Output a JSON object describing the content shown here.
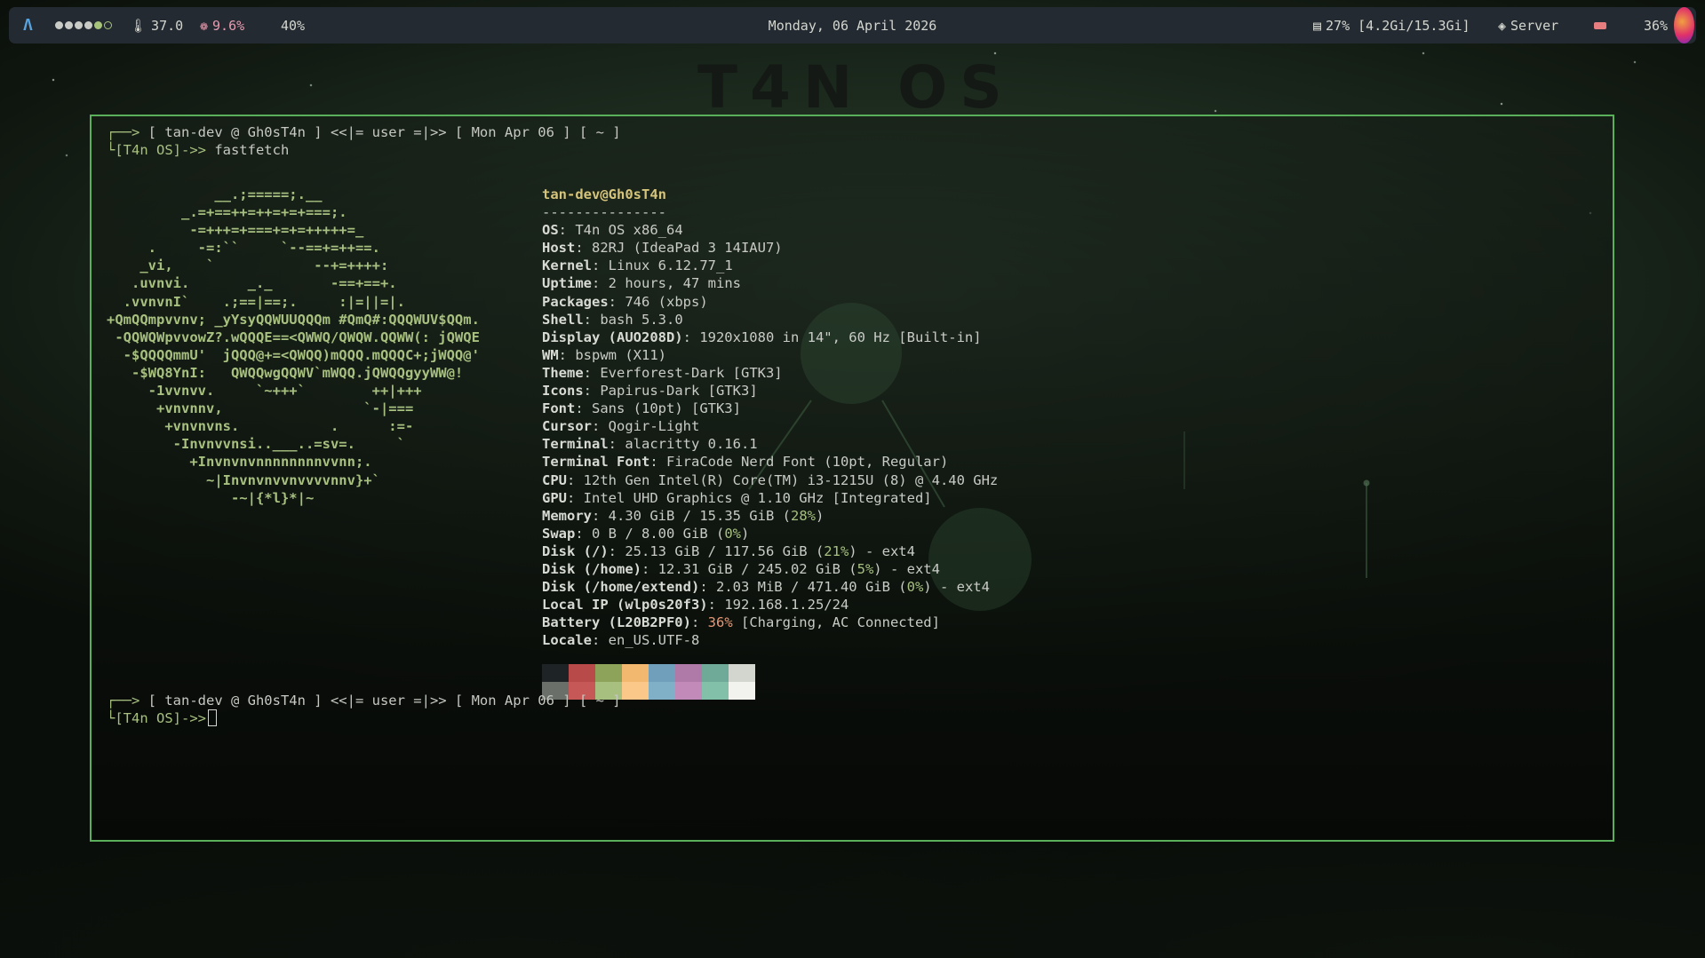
{
  "topbar": {
    "logo_icon": "arch-logo-icon",
    "workspaces": [
      true,
      true,
      true,
      true,
      true,
      false
    ],
    "temperature": "37.0",
    "cpu": "9.6%",
    "brightness": "40%",
    "clock": "Monday, 06 April 2026",
    "memory": "27% [4.2Gi/15.3Gi]",
    "network": "Server",
    "battery": "36%",
    "avatar_icon": "user-avatar"
  },
  "wallpaper_title": "T4N OS",
  "terminal": {
    "prompt1": {
      "arrow": "┌──>",
      "line": " [ tan-dev @ Gh0sT4n ] <<|= user =|>> [ Mon Apr 06 ] [ ~ ]",
      "ps": "└[T4n OS]->>",
      "cmd": " fastfetch"
    },
    "ascii_art": "             __.;=====;.__\n         _.=+==++=++=+=+===;.\n          -=+++=+===+=+=+++++=_\n     .     -=:``     `--==+=++==.\n    _vi,    `            --+=++++:\n   .uvnvi.       _._       -==+==+.\n  .vvnvnI`    .;==|==;.     :|=||=|.\n+QmQQmpvvnv; _yYsyQQWUUQQQm #QmQ#:QQQWUV$QQm.\n -QQWQWpvvowZ?.wQQQE==<QWWQ/QWQW.QQWW(: jQWQE\n  -$QQQQmmU'  jQQQ@+=<QWQQ)mQQQ.mQQQC+;jWQQ@'\n   -$WQ8YnI:   QWQQwgQQWV`mWQQ.jQWQQgyyWW@!\n     -1vvnvv.     `~+++`        ++|+++\n      +vnvnnv,                 `-|===\n       +vnvnvns.           .      :=-\n        -Invnvvnsi..___..=sv=.     `\n          +Invnvnvnnnnnnnnvvnn;.\n            ~|Invnvnvvnvvvvnnv}+`\n               -~|{*l}*|~",
    "info": [
      {
        "title": "tan-dev@Gh0sT4n"
      },
      {
        "sep": "---------------"
      },
      {
        "k": "OS",
        "v": "T4n OS x86_64"
      },
      {
        "k": "Host",
        "v": "82RJ (IdeaPad 3 14IAU7)"
      },
      {
        "k": "Kernel",
        "v": "Linux 6.12.77_1"
      },
      {
        "k": "Uptime",
        "v": "2 hours, 47 mins"
      },
      {
        "k": "Packages",
        "v": "746 (xbps)"
      },
      {
        "k": "Shell",
        "v": "bash 5.3.0"
      },
      {
        "k": "Display (AUO208D)",
        "v": "1920x1080 in 14\", 60 Hz [Built-in]"
      },
      {
        "k": "WM",
        "v": "bspwm (X11)"
      },
      {
        "k": "Theme",
        "v": "Everforest-Dark [GTK3]"
      },
      {
        "k": "Icons",
        "v": "Papirus-Dark [GTK3]"
      },
      {
        "k": "Font",
        "v": "Sans (10pt) [GTK3]"
      },
      {
        "k": "Cursor",
        "v": "Qogir-Light"
      },
      {
        "k": "Terminal",
        "v": "alacritty 0.16.1"
      },
      {
        "k": "Terminal Font",
        "v": "FiraCode Nerd Font (10pt, Regular)"
      },
      {
        "k": "CPU",
        "v": "12th Gen Intel(R) Core(TM) i3-1215U (8) @ 4.40 GHz"
      },
      {
        "k": "GPU",
        "v": "Intel UHD Graphics @ 1.10 GHz [Integrated]"
      },
      {
        "k": "Memory",
        "v": "4.30 GiB / 15.35 GiB (",
        "p": "28%",
        "after": ")",
        "pc": "grn"
      },
      {
        "k": "Swap",
        "v": "0 B / 8.00 GiB (",
        "p": "0%",
        "after": ")",
        "pc": "grn"
      },
      {
        "k": "Disk (/)",
        "v": "25.13 GiB / 117.56 GiB (",
        "p": "21%",
        "after": ") - ext4",
        "pc": "grn"
      },
      {
        "k": "Disk (/home)",
        "v": "12.31 GiB / 245.02 GiB (",
        "p": "5%",
        "after": ") - ext4",
        "pc": "grn"
      },
      {
        "k": "Disk (/home/extend)",
        "v": "2.03 MiB / 471.40 GiB (",
        "p": "0%",
        "after": ") - ext4",
        "pc": "grn"
      },
      {
        "k": "Local IP (wlp0s20f3)",
        "v": "192.168.1.25/24"
      },
      {
        "k": "Battery (L20B2PF0)",
        "v": "",
        "p": "36%",
        "after": " [Charging, AC Connected]",
        "pc": "org"
      },
      {
        "k": "Locale",
        "v": "en_US.UTF-8"
      }
    ],
    "palette": [
      "#1e2326",
      "#b84a4a",
      "#8ea35a",
      "#f2b870",
      "#6f9fba",
      "#b07aa8",
      "#6faa98",
      "#d3d6cf",
      "#6a6f6a",
      "#c65858",
      "#a7c080",
      "#fcc88a",
      "#7fb0c8",
      "#c28ab8",
      "#83c0aa",
      "#f2f2ee"
    ],
    "prompt2": {
      "arrow": "┌──>",
      "line": " [ tan-dev @ Gh0sT4n ] <<|= user =|>> [ Mon Apr 06 ] [ ~ ]",
      "ps": "└[T4n OS]->>"
    }
  }
}
